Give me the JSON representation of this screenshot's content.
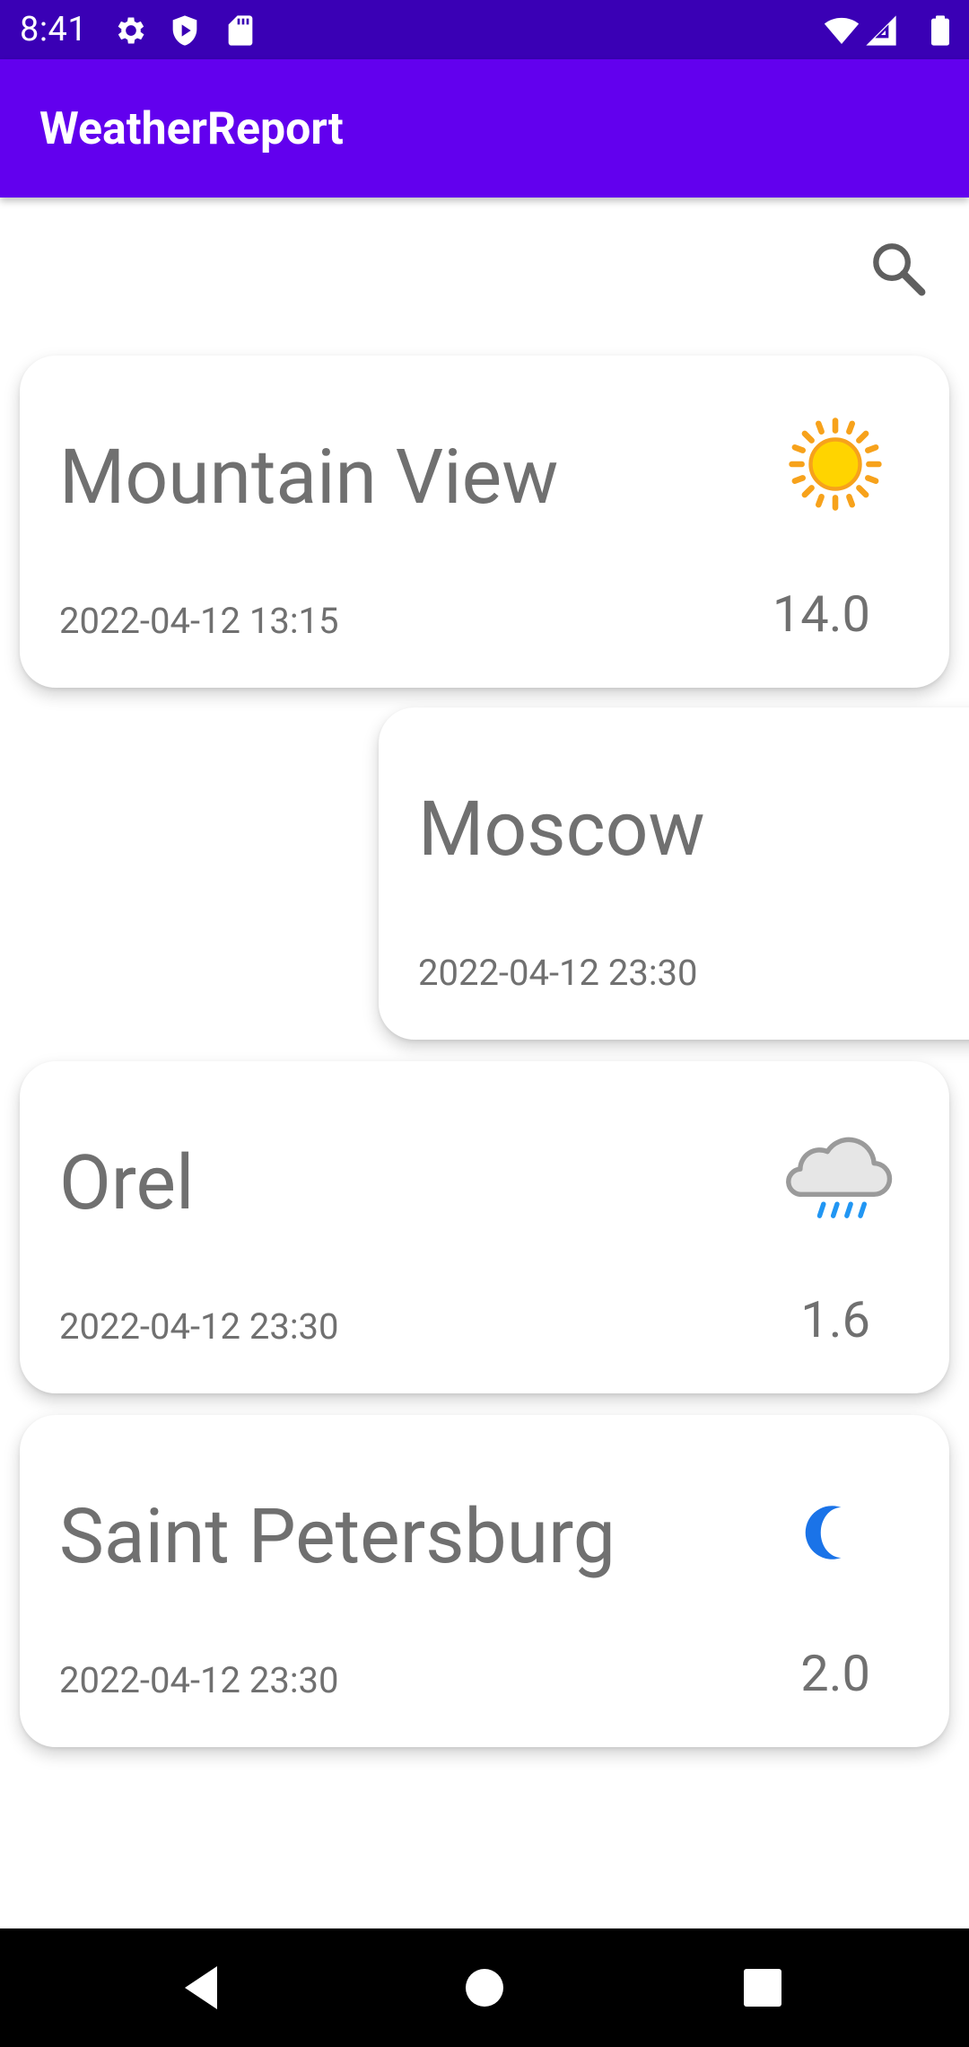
{
  "status_bar": {
    "time": "8:41",
    "background": "#3a00b5",
    "icons": [
      "gear-icon",
      "shield-icon",
      "sd-card-icon",
      "wifi-icon",
      "signal-icon",
      "battery-icon"
    ]
  },
  "app_bar": {
    "title": "WeatherReport",
    "background": "#6200ee"
  },
  "toolbar": {
    "search_icon": "search-icon"
  },
  "cards": [
    {
      "city": "Mountain View",
      "date": "2022-04-12 13:15",
      "temp": "14.0",
      "icon": "sun-icon"
    },
    {
      "city": "Moscow",
      "date": "2022-04-12 23:30",
      "temp": "",
      "icon": ""
    },
    {
      "city": "Orel",
      "date": "2022-04-12 23:30",
      "temp": "1.6",
      "icon": "rain-cloud-icon"
    },
    {
      "city": "Saint Petersburg",
      "date": "2022-04-12 23:30",
      "temp": "2.0",
      "icon": "moon-icon"
    }
  ],
  "nav_bar": {
    "buttons": [
      "back-icon",
      "home-icon",
      "recents-icon"
    ]
  }
}
